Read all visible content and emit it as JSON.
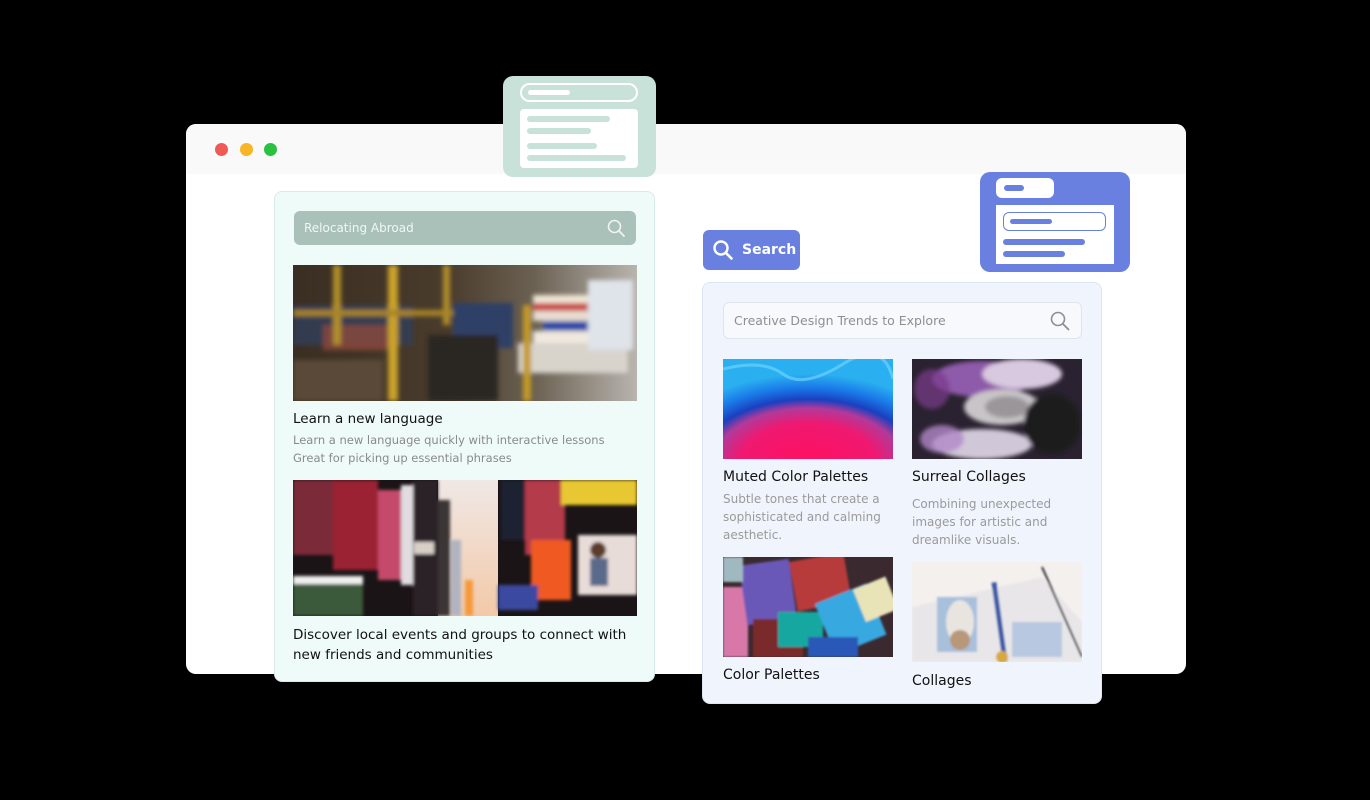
{
  "window": {
    "controls": [
      "close",
      "minimize",
      "maximize"
    ]
  },
  "left_panel": {
    "search": {
      "placeholder": "Relocating Abroad",
      "icon": "search-icon"
    },
    "items": [
      {
        "image": "bookstore-photo",
        "title": "Learn a new language",
        "description_lines": [
          "Learn a new language quickly with interactive lessons",
          "Great for picking up essential phrases"
        ]
      },
      {
        "image": "city-billboards-photo",
        "title_lines": [
          "Discover local events and groups to connect with",
          "new friends and communities"
        ]
      }
    ]
  },
  "right_panel": {
    "search_button": {
      "label": "Search",
      "icon": "search-icon"
    },
    "search": {
      "placeholder": "Creative Design Trends to Explore",
      "icon": "search-icon"
    },
    "tiles": [
      {
        "image": "blue-pink-ink-photo",
        "title": "Muted Color Palettes",
        "description_lines": [
          "Subtle tones that create a",
          "sophisticated and calming",
          "aesthetic."
        ]
      },
      {
        "image": "surreal-portrait-photo",
        "title": "Surreal Collages",
        "description_lines": [
          "Combining unexpected",
          "images for artistic and",
          "dreamlike visuals."
        ]
      },
      {
        "image": "paint-brushes-photo",
        "title": "Color Palettes"
      },
      {
        "image": "owl-journal-photo",
        "title": "Collages"
      }
    ]
  },
  "colors": {
    "accent_blue": "#6a80e0",
    "accent_green": "#c8e2da",
    "search_green": "#a9c1b9"
  }
}
